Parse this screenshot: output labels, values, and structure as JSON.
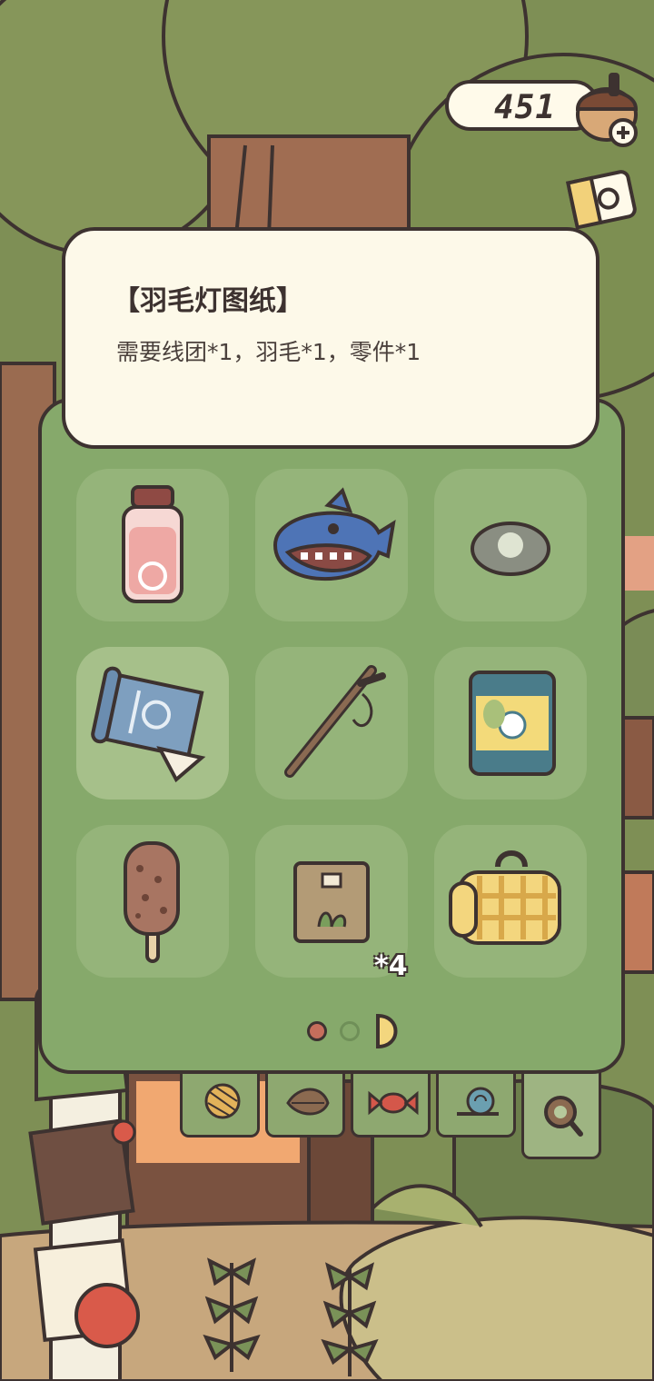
{
  "currency": {
    "value": "451",
    "icon": "acorn-icon",
    "add_icon": "plus-icon"
  },
  "tooltip": {
    "title": "【羽毛灯图纸】",
    "description": "需要线团*1，羽毛*1，零件*1"
  },
  "inventory": {
    "slots": [
      {
        "icon": "bottle-icon",
        "selected": false
      },
      {
        "icon": "shark-toy-icon",
        "selected": false
      },
      {
        "icon": "stone-icon",
        "selected": false
      },
      {
        "icon": "blueprint-icon",
        "selected": true
      },
      {
        "icon": "stick-icon",
        "selected": false
      },
      {
        "icon": "snack-bag-icon",
        "selected": false
      },
      {
        "icon": "popsicle-icon",
        "selected": false
      },
      {
        "icon": "paper-bag-icon",
        "selected": false,
        "count": "*4"
      },
      {
        "icon": "picnic-mat-icon",
        "selected": false
      }
    ],
    "pagination": {
      "current": 1,
      "total": 2
    }
  },
  "tabs": [
    {
      "icon": "yarn-icon"
    },
    {
      "icon": "leaf-icon"
    },
    {
      "icon": "candy-icon"
    },
    {
      "icon": "snail-icon"
    },
    {
      "icon": "magnifier-icon",
      "active": true
    }
  ],
  "colors": {
    "panel": "#86a96b",
    "slot": "#95b47a",
    "outline": "#3d3230",
    "tooltip_bg": "#fdf9e9"
  }
}
